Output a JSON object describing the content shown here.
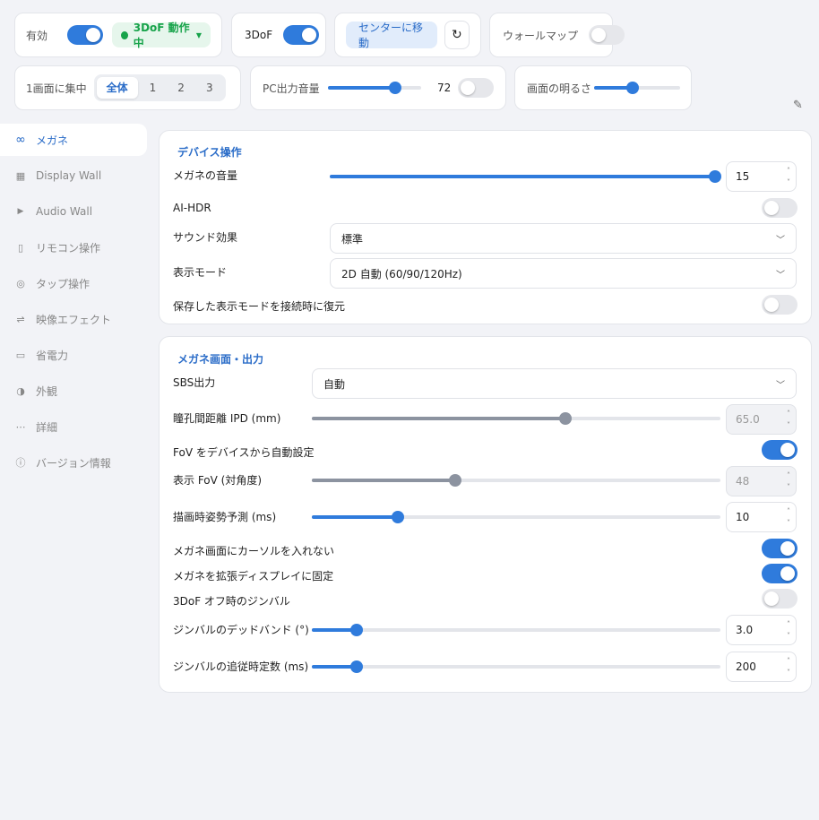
{
  "top": {
    "enabled_label": "有効",
    "status_label": "3DoF 動作中",
    "dof_label": "3DoF",
    "center_button": "センターに移動",
    "wallmap_label": "ウォールマップ",
    "focus_label": "1画面に集中",
    "focus_options": [
      "全体",
      "1",
      "2",
      "3"
    ],
    "focus_selected": "全体",
    "pc_volume_label": "PC出力音量",
    "pc_volume_value": "72",
    "pc_volume_level": 72,
    "brightness_label": "画面の明るさ",
    "brightness_level": 45
  },
  "sidebar": {
    "items": [
      {
        "label": "メガネ",
        "icon": "infinity-icon"
      },
      {
        "label": "Display Wall",
        "icon": "grid-icon"
      },
      {
        "label": "Audio Wall",
        "icon": "play-icon"
      },
      {
        "label": "リモコン操作",
        "icon": "remote-icon"
      },
      {
        "label": "タップ操作",
        "icon": "tap-icon"
      },
      {
        "label": "映像エフェクト",
        "icon": "sliders-icon"
      },
      {
        "label": "省電力",
        "icon": "battery-icon"
      },
      {
        "label": "外観",
        "icon": "contrast-icon"
      },
      {
        "label": "詳細",
        "icon": "ellipsis-icon"
      },
      {
        "label": "バージョン情報",
        "icon": "info-icon"
      }
    ]
  },
  "device": {
    "title": "デバイス操作",
    "volume_label": "メガネの音量",
    "volume_value": "15",
    "ai_hdr_label": "AI-HDR",
    "sound_label": "サウンド効果",
    "sound_value": "標準",
    "display_mode_label": "表示モード",
    "display_mode_value": "2D 自動 (60/90/120Hz)",
    "restore_label": "保存した表示モードを接続時に復元"
  },
  "output": {
    "title": "メガネ画面・出力",
    "sbs_label": "SBS出力",
    "sbs_value": "自動",
    "ipd_label": "瞳孔間距離 IPD (mm)",
    "ipd_value": "65.0",
    "fov_auto_label": "FoV をデバイスから自動設定",
    "fov_label": "表示 FoV (対角度)",
    "fov_value": "48",
    "predict_label": "描画時姿勢予測 (ms)",
    "predict_value": "10",
    "no_cursor_label": "メガネ画面にカーソルを入れない",
    "lock_label": "メガネを拡張ディスプレイに固定",
    "gimbal_label": "3DoF オフ時のジンバル",
    "deadband_label": "ジンバルのデッドバンド (°)",
    "deadband_value": "3.0",
    "follow_label": "ジンバルの追従時定数 (ms)",
    "follow_value": "200"
  }
}
